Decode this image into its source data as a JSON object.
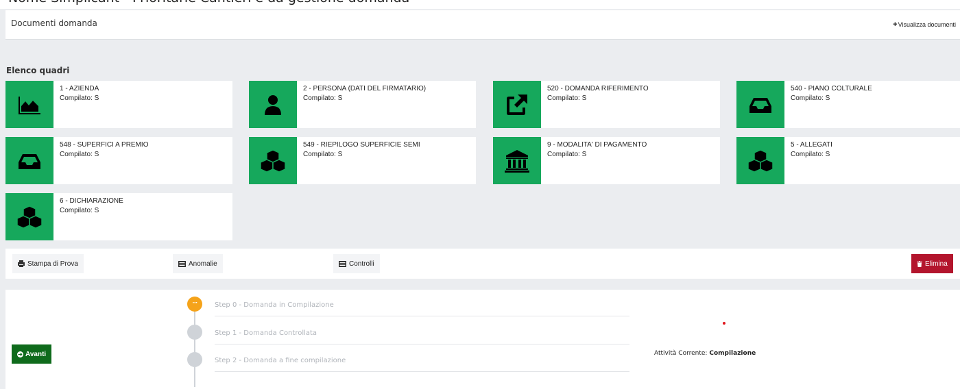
{
  "top_banner_text": "Nome Simplicant - Prioritarie Cantieri e da gestione domanda",
  "panel": {
    "title": "Documenti domanda",
    "view_docs_icon": "plus-icon",
    "view_docs_label": "Visualizza documenti"
  },
  "section_label": "Elenco quadri",
  "tiles": [
    {
      "title": "1 - AZIENDA",
      "status": "Compilato: S",
      "icon": "area-chart-icon"
    },
    {
      "title": "2 - PERSONA (DATI DEL FIRMATARIO)",
      "status": "Compilato: S",
      "icon": "user-icon"
    },
    {
      "title": "520 - DOMANDA RIFERIMENTO",
      "status": "Compilato: S",
      "icon": "external-link-icon"
    },
    {
      "title": "540 - PIANO COLTURALE",
      "status": "Compilato: S",
      "icon": "inbox-icon"
    },
    {
      "title": "548 - SUPERFICI A PREMIO",
      "status": "Compilato: S",
      "icon": "inbox-icon"
    },
    {
      "title": "549 - RIEPILOGO SUPERFICIE SEMI",
      "status": "Compilato: S",
      "icon": "cubes-icon"
    },
    {
      "title": "9 - MODALITA' DI PAGAMENTO",
      "status": "Compilato: S",
      "icon": "bank-icon"
    },
    {
      "title": "5 - ALLEGATI",
      "status": "Compilato: S",
      "icon": "cubes-icon"
    },
    {
      "title": "6 - DICHIARAZIONE",
      "status": "Compilato: S",
      "icon": "cubes-icon"
    }
  ],
  "actions": {
    "print_label": "Stampa di Prova",
    "anomalies_label": "Anomalie",
    "checks_label": "Controlli",
    "delete_label": "Elimina"
  },
  "workflow": {
    "next_label": "Avanti",
    "steps": [
      {
        "label": "Step 0 - Domanda in Compilazione",
        "state": "active"
      },
      {
        "label": "Step 1 - Domanda Controllata",
        "state": "pending"
      },
      {
        "label": "Step 2 - Domanda a fine compilazione",
        "state": "pending"
      }
    ],
    "current_activity_label": "Attività Corrente:",
    "current_activity_value": "Compilazione"
  },
  "colors": {
    "tile_icon_bg": "#16a85c",
    "danger": "#b3152d",
    "next_button": "#0f6b1c",
    "active_step": "#f5a31a",
    "pending_step": "#cfd3d8"
  }
}
